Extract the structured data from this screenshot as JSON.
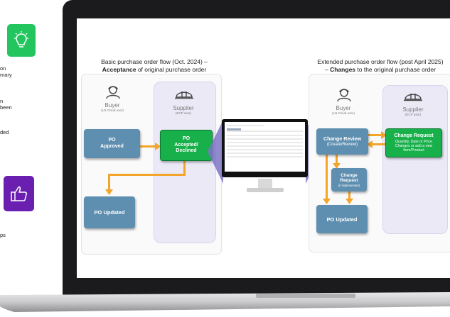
{
  "left_column": {
    "lines": [
      "on",
      "mary",
      "n",
      "been",
      "ded",
      "ps"
    ],
    "icon_1": "lightbulb-icon",
    "icon_2": "thumbs-up-icon",
    "icon_1_color": "#22c55e",
    "icon_2_color": "#6a1fb0"
  },
  "basic_flow": {
    "title_line1": "Basic purchase order flow (Oct. 2024) –",
    "title_bold": "Acceptance",
    "title_rest": " of original purchase order",
    "buyer": {
      "name": "Buyer",
      "sub": "(LN Cloud user)"
    },
    "supplier": {
      "name": "Supplier",
      "sub": "(ECP user)"
    },
    "po_approved": {
      "line1": "PO",
      "line2": "Approved"
    },
    "po_accepted": {
      "line1": "PO",
      "line2": "Accepted/",
      "line3": "Declined"
    },
    "po_updated": "PO Updated"
  },
  "extended_flow": {
    "title_line1": "Extended purchase order flow (post April 2025)",
    "title_dash": "– ",
    "title_bold": "Changes",
    "title_rest": " to the original purchase order",
    "buyer": {
      "name": "Buyer",
      "sub": "(LN Cloud user)"
    },
    "supplier": {
      "name": "Supplier",
      "sub": "(ECP user)"
    },
    "change_review": {
      "line1": "Change Review",
      "line2": "(Create/Review)"
    },
    "change_request_supplier": {
      "title": "Change Request",
      "desc": "Quantity, Date or Price Changes or add a new Item/Product"
    },
    "change_request_buyer": {
      "line1": "Change",
      "line2": "Request",
      "line3": "(if implemented)"
    },
    "po_updated": "PO Updated"
  },
  "colors": {
    "box_blue": "#5f8fb0",
    "box_green": "#18b04a",
    "arrow": "#f2a52a",
    "lane": "#ece9f7"
  }
}
